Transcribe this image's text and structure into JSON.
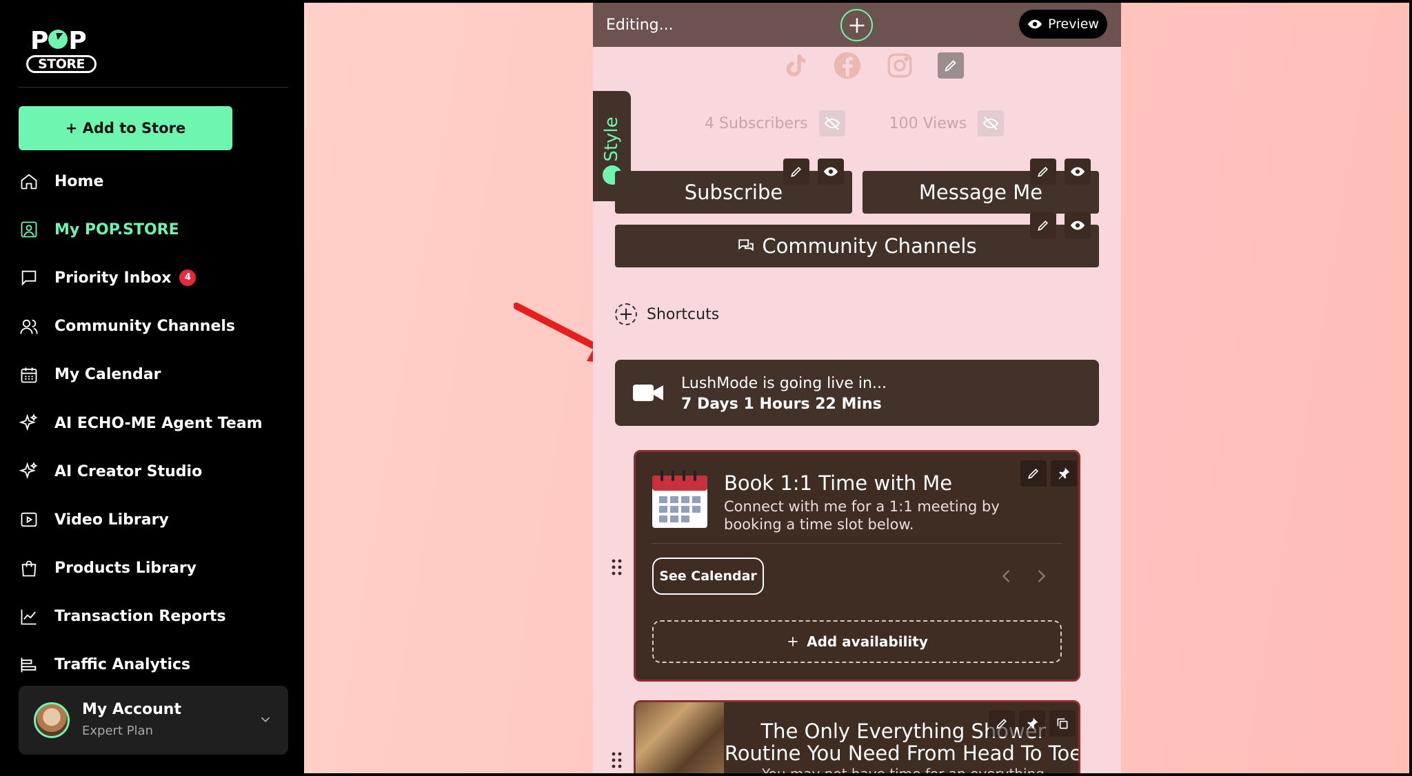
{
  "sidebar": {
    "logo_top": "POP",
    "logo_bottom": "STORE",
    "add_button": "+ Add to Store",
    "items": [
      {
        "label": "Home",
        "icon": "home-icon"
      },
      {
        "label": "My POP.STORE",
        "icon": "store-icon",
        "active": true
      },
      {
        "label": "Priority Inbox",
        "icon": "inbox-icon",
        "badge": "4"
      },
      {
        "label": "Community Channels",
        "icon": "users-icon"
      },
      {
        "label": "My Calendar",
        "icon": "calendar-icon"
      },
      {
        "label": "AI ECHO-ME Agent Team",
        "icon": "sparkle-icon"
      },
      {
        "label": "AI Creator Studio",
        "icon": "sparkle-icon"
      },
      {
        "label": "Video Library",
        "icon": "video-icon"
      },
      {
        "label": "Products Library",
        "icon": "bag-icon"
      },
      {
        "label": "Transaction Reports",
        "icon": "chart-icon"
      },
      {
        "label": "Traffic Analytics",
        "icon": "analytics-icon"
      }
    ],
    "account": {
      "name": "My Account",
      "plan": "Expert Plan"
    }
  },
  "editor": {
    "status": "Editing...",
    "preview": "Preview",
    "style_tab": "Style",
    "subscribers": "4 Subscribers",
    "views": "100 Views",
    "subscribe_button": "Subscribe",
    "message_button": "Message Me",
    "community_button": "Community Channels",
    "shortcuts": "Shortcuts",
    "live": {
      "line1": "LushMode is going live in...",
      "line2": "7 Days 1 Hours 22 Mins"
    },
    "booking_card": {
      "title": "Book 1:1 Time with Me",
      "description": "Connect with me for a 1:1 meeting by booking a time slot below.",
      "see_calendar": "See Calendar",
      "add_availability": "Add availability"
    },
    "product_card": {
      "title": "The Only Everything Shower Routine You Need From Head To Toe",
      "subtitle": "You may not have time for an everything"
    }
  },
  "colors": {
    "accent": "#6ef5b0",
    "dark_brown": "#433229",
    "badge_red": "#e8283c",
    "canvas_bg": "#ffc8c2",
    "phone_bg": "#f8d8dc"
  }
}
